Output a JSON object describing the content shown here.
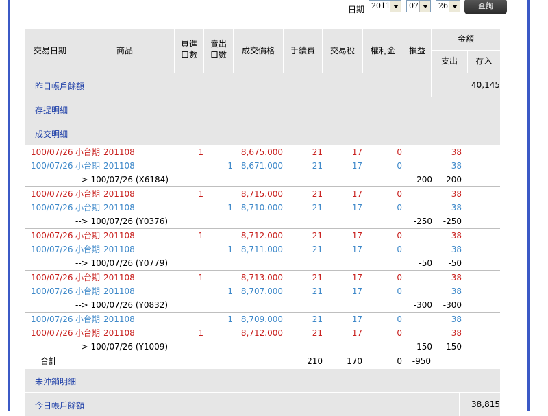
{
  "toolbar": {
    "date_label": "日期",
    "year": "2011",
    "month": "07",
    "day": "26",
    "query_button": "查詢"
  },
  "header": {
    "trade_date": "交易日期",
    "product": "商品",
    "buy_qty_1": "買進",
    "buy_qty_2": "口數",
    "sell_qty_1": "賣出",
    "sell_qty_2": "口數",
    "price": "成交價格",
    "fee": "手續費",
    "tax": "交易稅",
    "royalty": "權利金",
    "pnl": "損益",
    "amount": "金額",
    "expense": "支出",
    "deposit": "存入"
  },
  "sections": {
    "prev_balance": "昨日帳戶餘額",
    "prev_balance_value": "40,145",
    "deposit_withdraw": "存提明細",
    "trades": "成交明細",
    "open_positions": "未沖銷明細",
    "today_balance": "今日帳戶餘額",
    "today_balance_value": "38,815"
  },
  "trades": [
    {
      "type": "red",
      "date": "100/07/26",
      "product": "小台期",
      "month": "201108",
      "buy": "1",
      "sell": "",
      "price": "8,675.000",
      "fee": "21",
      "tax": "17",
      "royalty": "0",
      "expense": "38"
    },
    {
      "type": "blue",
      "date": "100/07/26",
      "product": "小台期",
      "month": "201108",
      "buy": "",
      "sell": "1",
      "price": "8,671.000",
      "fee": "21",
      "tax": "17",
      "royalty": "0",
      "expense": "38"
    },
    {
      "type": "sub",
      "text": "--> 100/07/26 (X6184)",
      "pnl": "-200",
      "expense": "-200"
    },
    {
      "type": "red",
      "date": "100/07/26",
      "product": "小台期",
      "month": "201108",
      "buy": "1",
      "sell": "",
      "price": "8,715.000",
      "fee": "21",
      "tax": "17",
      "royalty": "0",
      "expense": "38"
    },
    {
      "type": "blue",
      "date": "100/07/26",
      "product": "小台期",
      "month": "201108",
      "buy": "",
      "sell": "1",
      "price": "8,710.000",
      "fee": "21",
      "tax": "17",
      "royalty": "0",
      "expense": "38"
    },
    {
      "type": "sub",
      "text": "--> 100/07/26 (Y0376)",
      "pnl": "-250",
      "expense": "-250"
    },
    {
      "type": "red",
      "date": "100/07/26",
      "product": "小台期",
      "month": "201108",
      "buy": "1",
      "sell": "",
      "price": "8,712.000",
      "fee": "21",
      "tax": "17",
      "royalty": "0",
      "expense": "38"
    },
    {
      "type": "blue",
      "date": "100/07/26",
      "product": "小台期",
      "month": "201108",
      "buy": "",
      "sell": "1",
      "price": "8,711.000",
      "fee": "21",
      "tax": "17",
      "royalty": "0",
      "expense": "38"
    },
    {
      "type": "sub",
      "text": "--> 100/07/26 (Y0779)",
      "pnl": "-50",
      "expense": "-50"
    },
    {
      "type": "red",
      "date": "100/07/26",
      "product": "小台期",
      "month": "201108",
      "buy": "1",
      "sell": "",
      "price": "8,713.000",
      "fee": "21",
      "tax": "17",
      "royalty": "0",
      "expense": "38"
    },
    {
      "type": "blue",
      "date": "100/07/26",
      "product": "小台期",
      "month": "201108",
      "buy": "",
      "sell": "1",
      "price": "8,707.000",
      "fee": "21",
      "tax": "17",
      "royalty": "0",
      "expense": "38"
    },
    {
      "type": "sub",
      "text": "--> 100/07/26 (Y0832)",
      "pnl": "-300",
      "expense": "-300"
    },
    {
      "type": "blue",
      "date": "100/07/26",
      "product": "小台期",
      "month": "201108",
      "buy": "",
      "sell": "1",
      "price": "8,709.000",
      "fee": "21",
      "tax": "17",
      "royalty": "0",
      "expense": "38"
    },
    {
      "type": "red",
      "date": "100/07/26",
      "product": "小台期",
      "month": "201108",
      "buy": "1",
      "sell": "",
      "price": "8,712.000",
      "fee": "21",
      "tax": "17",
      "royalty": "0",
      "expense": "38"
    },
    {
      "type": "sub",
      "text": "--> 100/07/26 (Y1009)",
      "pnl": "-150",
      "expense": "-150"
    }
  ],
  "summary": {
    "label": "合計",
    "fee": "210",
    "tax": "170",
    "royalty": "0",
    "pnl": "-950"
  }
}
